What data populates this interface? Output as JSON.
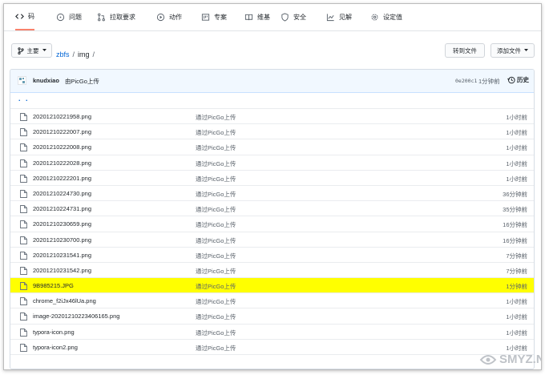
{
  "tabs": [
    {
      "label": "码",
      "icon": "code-icon",
      "selected": true
    },
    {
      "label": "问题",
      "icon": "issue-icon"
    },
    {
      "label": "拉取要求",
      "icon": "pull-request-icon"
    },
    {
      "label": "动作",
      "icon": "play-icon"
    },
    {
      "label": "专案",
      "icon": "project-icon"
    },
    {
      "label": "维基",
      "icon": "book-icon"
    },
    {
      "label": "安全",
      "icon": "shield-icon"
    },
    {
      "label": "见解",
      "icon": "graph-icon"
    },
    {
      "label": "设定值",
      "icon": "gear-icon"
    }
  ],
  "toolbar": {
    "branch_label": "主要",
    "goto_file_label": "转到文件",
    "add_file_label": "添加文件"
  },
  "breadcrumb": {
    "repo": "zbfs",
    "sep1": "/",
    "folder": "img",
    "sep2": "/"
  },
  "commit": {
    "author": "knudxiao",
    "message": "由PicGo上传",
    "sha": "0e200c1",
    "time": "1分钟前",
    "history_label": "历史"
  },
  "parent_link": ". .",
  "files": [
    {
      "name": "20201210221958.png",
      "message": "通过PicGo上传",
      "time": "1小时前"
    },
    {
      "name": "20201210222007.png",
      "message": "通过PicGo上传",
      "time": "1小时前"
    },
    {
      "name": "20201210222008.png",
      "message": "通过PicGo上传",
      "time": "1小时前"
    },
    {
      "name": "20201210222028.png",
      "message": "通过PicGo上传",
      "time": "1小时前"
    },
    {
      "name": "20201210222201.png",
      "message": "通过PicGo上传",
      "time": "1小时前"
    },
    {
      "name": "20201210224730.png",
      "message": "通过PicGo上传",
      "time": "36分钟前"
    },
    {
      "name": "20201210224731.png",
      "message": "通过PicGo上传",
      "time": "35分钟前"
    },
    {
      "name": "20201210230659.png",
      "message": "通过PicGo上传",
      "time": "16分钟前"
    },
    {
      "name": "20201210230700.png",
      "message": "通过PicGo上传",
      "time": "16分钟前"
    },
    {
      "name": "20201210231541.png",
      "message": "通过PicGo上传",
      "time": "7分钟前"
    },
    {
      "name": "20201210231542.png",
      "message": "通过PicGo上传",
      "time": "7分钟前"
    },
    {
      "name": "9B985215.JPG",
      "message": "通过PicGo上传",
      "time": "1分钟前",
      "highlighted": true
    },
    {
      "name": "chrome_f2iJx46lUa.png",
      "message": "通过PicGo上传",
      "time": "1小时前"
    },
    {
      "name": "image-20201210223406165.png",
      "message": "通过PicGo上传",
      "time": "1小时前"
    },
    {
      "name": "typora-icon.png",
      "message": "通过PicGo上传",
      "time": "1小时前"
    },
    {
      "name": "typora-icon2.png",
      "message": "通过PicGo上传",
      "time": "1小时前"
    }
  ],
  "watermark": {
    "text": "SMYZ.NET"
  },
  "colors": {
    "highlight": "#ffff00",
    "link": "#0366d6",
    "selected_tab": "#f9826c",
    "commit_bar": "#f1f8ff"
  }
}
